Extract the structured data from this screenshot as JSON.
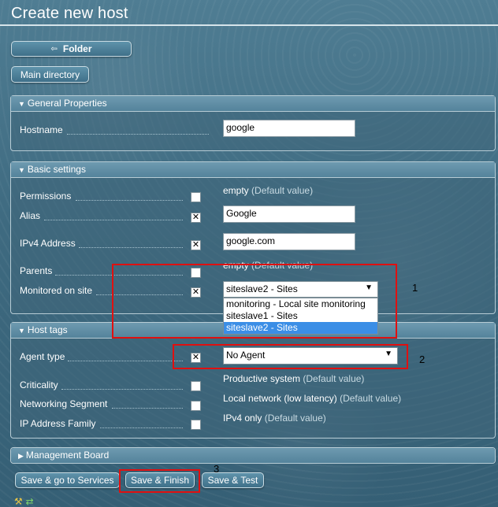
{
  "page": {
    "title": "Create new host"
  },
  "nav": {
    "folder_label": "Folder",
    "main_directory_label": "Main directory"
  },
  "general": {
    "header": "General Properties",
    "hostname_label": "Hostname",
    "hostname_value": "google"
  },
  "basic": {
    "header": "Basic settings",
    "permissions_label": "Permissions",
    "permissions_value": "empty",
    "permissions_default": "(Default value)",
    "alias_label": "Alias",
    "alias_value": "Google",
    "ipv4_label": "IPv4 Address",
    "ipv4_value": "google.com",
    "parents_label": "Parents",
    "parents_value": "empty",
    "parents_default": "(Default value)",
    "site_label": "Monitored on site",
    "site_selected": "siteslave2 - Sites",
    "site_options": [
      "monitoring - Local site monitoring",
      "siteslave1 - Sites",
      "siteslave2 - Sites"
    ]
  },
  "tags": {
    "header": "Host tags",
    "agent_label": "Agent type",
    "agent_selected": "No Agent",
    "criticality_label": "Criticality",
    "criticality_value": "Productive system",
    "criticality_default": "(Default value)",
    "networking_label": "Networking Segment",
    "networking_value": "Local network (low latency)",
    "networking_default": "(Default value)",
    "ipfamily_label": "IP Address Family",
    "ipfamily_value": "IPv4 only",
    "ipfamily_default": "(Default value)"
  },
  "management": {
    "header": "Management Board"
  },
  "actions": {
    "save_services": "Save & go to Services",
    "save_finish": "Save & Finish",
    "save_test": "Save & Test"
  },
  "annotations": {
    "n1": "1",
    "n2": "2",
    "n3": "3"
  },
  "colors": {
    "highlight": "#e01010",
    "selected_option": "#3b8ee6"
  },
  "icons": {
    "folder": "back-arrow-icon",
    "section_open": "triangle-down-icon",
    "section_closed": "triangle-right-icon"
  }
}
